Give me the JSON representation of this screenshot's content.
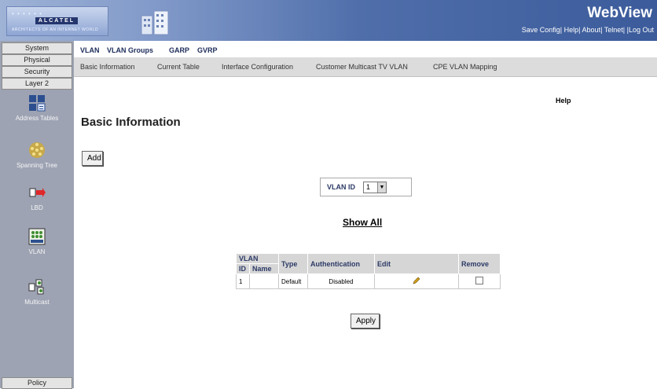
{
  "header": {
    "logo_text": "ALCATEL",
    "logo_tagline": "ARCHITECTS OF AN INTERNET WORLD",
    "brand": "WebView",
    "links": [
      "Save Config|",
      "Help|",
      "About|",
      "Telnet|",
      "|Log Out"
    ]
  },
  "leftnav": {
    "top_buttons": [
      "System",
      "Physical",
      "Security",
      "Layer 2"
    ],
    "icons": [
      {
        "label": "Address Tables",
        "icon": "address-tables-icon"
      },
      {
        "label": "Spanning Tree",
        "icon": "spanning-tree-icon"
      },
      {
        "label": "LBD",
        "icon": "lbd-icon"
      },
      {
        "label": "VLAN",
        "icon": "vlan-icon"
      },
      {
        "label": "Multicast",
        "icon": "multicast-icon"
      }
    ],
    "bottom_button": "Policy"
  },
  "tabs": [
    "VLAN",
    "VLAN Groups",
    "GARP",
    "GVRP"
  ],
  "subtabs": [
    "Basic Information",
    "Current Table",
    "Interface Configuration",
    "Customer Multicast TV VLAN",
    "CPE VLAN Mapping"
  ],
  "main": {
    "help": "Help",
    "title": "Basic Information",
    "add_label": "Add",
    "vlan_id_label": "VLAN ID",
    "vlan_id_value": "1",
    "show_all": "Show All",
    "apply_label": "Apply"
  },
  "table": {
    "headers_top": [
      "VLAN",
      "Type",
      "Authentication",
      "Edit",
      "Remove"
    ],
    "headers_sub": [
      "ID",
      "Name"
    ],
    "rows": [
      {
        "id": "1",
        "name": "",
        "type": "Default",
        "authentication": "Disabled"
      }
    ]
  }
}
